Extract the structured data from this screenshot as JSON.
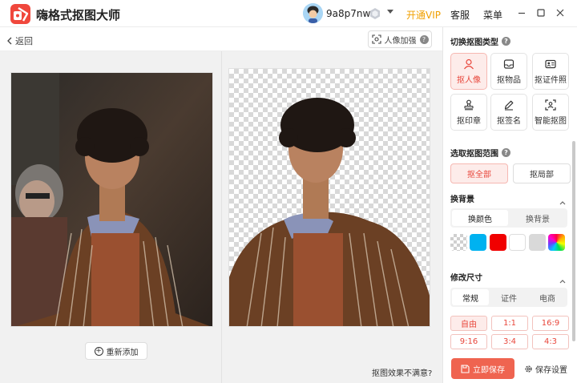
{
  "app": {
    "title": "嗨格式抠图大师",
    "brand_color": "#f0473c"
  },
  "user": {
    "name": "9a8p7nw",
    "open_vip": "开通VIP",
    "service": "客服",
    "menu": "菜单"
  },
  "toolbar": {
    "back": "返回",
    "portrait_enhance": "人像加强"
  },
  "canvas": {
    "readd": "重新添加",
    "dissatisfied": "抠图效果不满意?"
  },
  "panel": {
    "type_title": "切换抠图类型",
    "types": [
      {
        "label": "抠人像",
        "icon": "person-icon",
        "active": true
      },
      {
        "label": "抠物品",
        "icon": "inbox-icon",
        "active": false
      },
      {
        "label": "抠证件照",
        "icon": "id-card-icon",
        "active": false
      },
      {
        "label": "抠印章",
        "icon": "stamp-icon",
        "active": false
      },
      {
        "label": "抠签名",
        "icon": "pen-icon",
        "active": false
      },
      {
        "label": "智能抠图",
        "icon": "smart-scan-icon",
        "active": false
      }
    ],
    "range_title": "选取抠图范围",
    "range": {
      "all": "抠全部",
      "part": "抠局部"
    },
    "bg_title": "换背景",
    "bg_tabs": {
      "color": "换颜色",
      "image": "换背景"
    },
    "swatches": [
      "transparent",
      "#00b2f0",
      "#f00000",
      "#ffffff",
      "#d9d9d9",
      "rainbow"
    ],
    "size_title": "修改尺寸",
    "size_tabs": {
      "normal": "常规",
      "id": "证件",
      "ecommerce": "电商"
    },
    "sizes": [
      "自由",
      "1:1",
      "16:9",
      "9:16",
      "3:4",
      "4:3"
    ],
    "save_now": "立即保存",
    "save_settings": "保存设置"
  }
}
